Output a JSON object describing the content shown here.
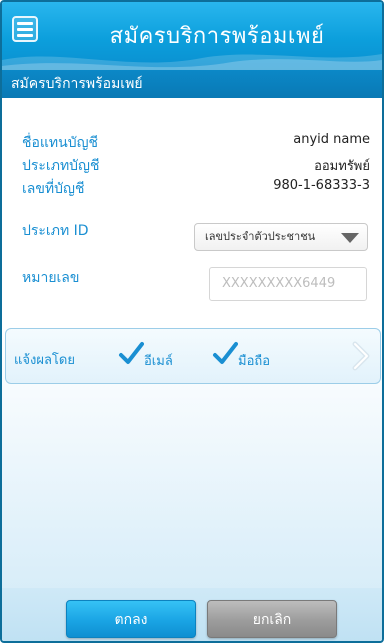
{
  "header": {
    "title": "สมัครบริการพร้อมเพย์",
    "menu_icon": "hamburger-menu-icon"
  },
  "section": {
    "title": "สมัครบริการพร้อมเพย์"
  },
  "form": {
    "account_name_label": "ชื่อแทนบัญชี",
    "account_name_value": "anyid name",
    "account_type_label": "ประเภทบัญชี",
    "account_type_value": "ออมทรัพย์",
    "account_number_label": "เลขที่บัญชี",
    "account_number_value": "980-1-68333-3",
    "id_type_label": "ประเภท ID",
    "id_type_selected": "เลขประจำตัวประชาชน",
    "id_number_label": "หมายเลข",
    "id_number_value": "XXXXXXXXX6449"
  },
  "notify": {
    "label": "แจ้งผลโดย",
    "options": [
      {
        "label": "อีเมล์",
        "checked": true
      },
      {
        "label": "มือถือ",
        "checked": true
      }
    ],
    "next_icon": "chevron-right-icon"
  },
  "actions": {
    "ok_label": "ตกลง",
    "cancel_label": "ยกเลิก"
  },
  "colors": {
    "primary": "#0c9fdc",
    "label_text": "#1a8fd2",
    "ok_button": "#1aa4e4",
    "cancel_button": "#9c9c9c"
  }
}
